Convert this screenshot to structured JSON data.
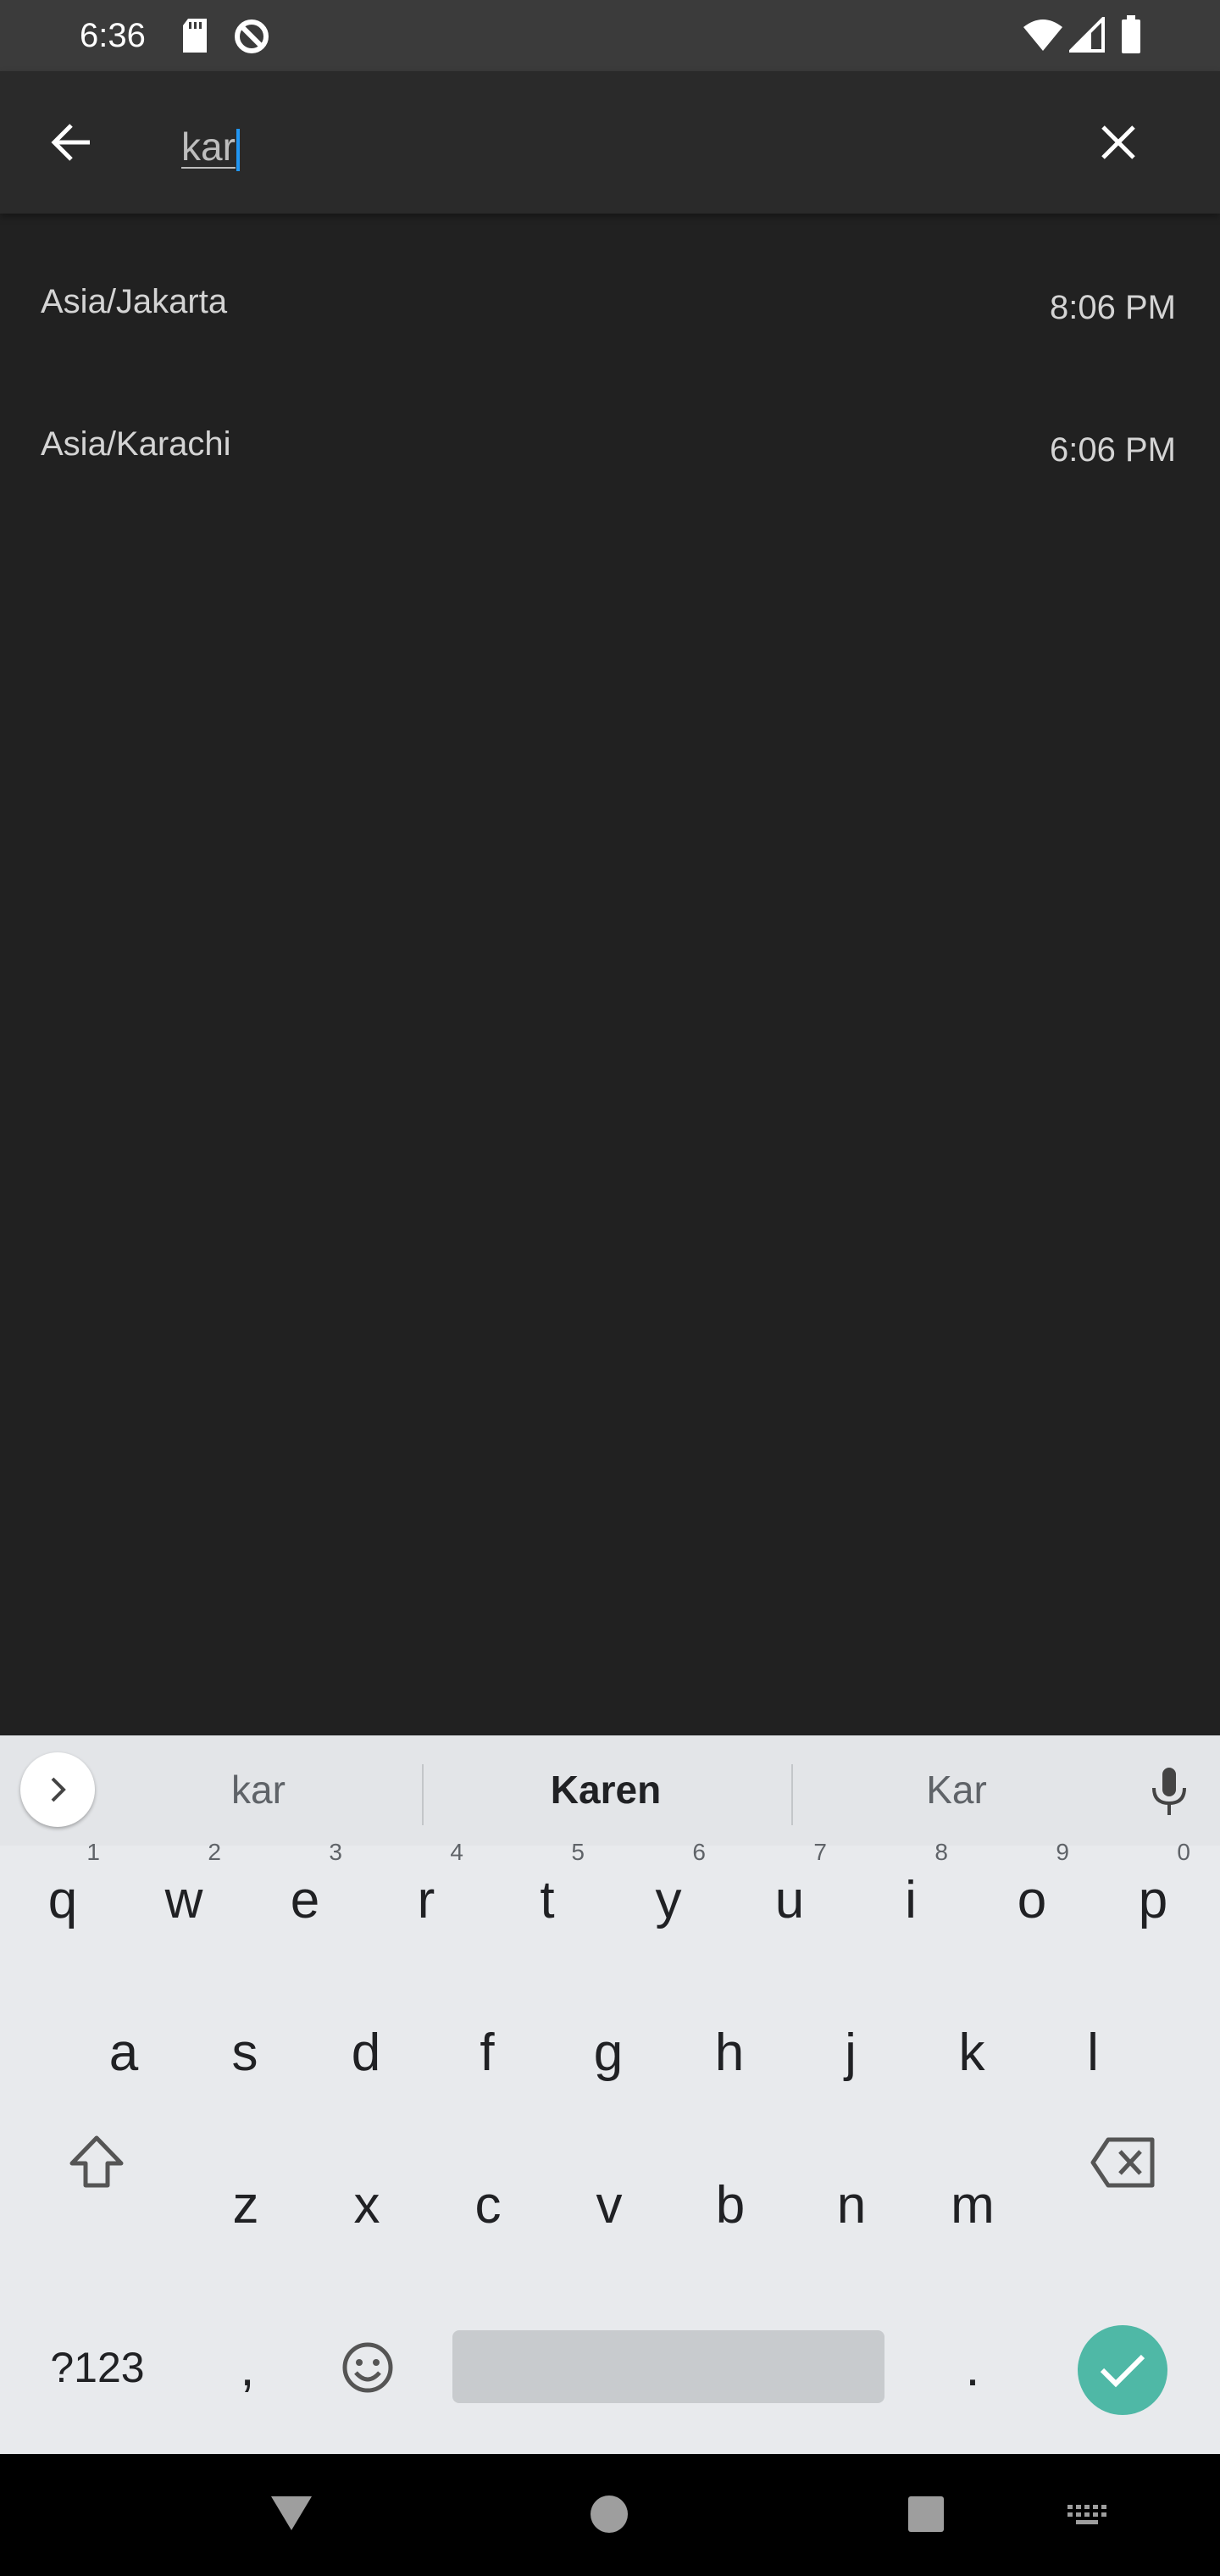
{
  "status_bar": {
    "time": "6:36",
    "icons": [
      "sd-card-icon",
      "do-not-disturb-icon",
      "wifi-icon",
      "signal-icon",
      "battery-icon"
    ]
  },
  "search_bar": {
    "query": "kar",
    "back_icon": "arrow-left-icon",
    "clear_icon": "close-icon"
  },
  "results": [
    {
      "zone": "Asia/Jakarta",
      "time": "8:06 PM"
    },
    {
      "zone": "Asia/Karachi",
      "time": "6:06 PM"
    }
  ],
  "keyboard": {
    "suggestions": [
      "kar",
      "Karen",
      "Kar"
    ],
    "rows": [
      [
        {
          "k": "q",
          "h": "1"
        },
        {
          "k": "w",
          "h": "2"
        },
        {
          "k": "e",
          "h": "3"
        },
        {
          "k": "r",
          "h": "4"
        },
        {
          "k": "t",
          "h": "5"
        },
        {
          "k": "y",
          "h": "6"
        },
        {
          "k": "u",
          "h": "7"
        },
        {
          "k": "i",
          "h": "8"
        },
        {
          "k": "o",
          "h": "9"
        },
        {
          "k": "p",
          "h": "0"
        }
      ],
      [
        {
          "k": "a"
        },
        {
          "k": "s"
        },
        {
          "k": "d"
        },
        {
          "k": "f"
        },
        {
          "k": "g"
        },
        {
          "k": "h"
        },
        {
          "k": "j"
        },
        {
          "k": "k"
        },
        {
          "k": "l"
        }
      ],
      [
        {
          "k": "z"
        },
        {
          "k": "x"
        },
        {
          "k": "c"
        },
        {
          "k": "v"
        },
        {
          "k": "b"
        },
        {
          "k": "n"
        },
        {
          "k": "m"
        }
      ]
    ],
    "symbols_label": "?123",
    "comma": ",",
    "period": ".",
    "accent_color": "#4fb8a6"
  },
  "nav_bar": {
    "icons": [
      "back-triangle-icon",
      "home-circle-icon",
      "recents-square-icon",
      "keyboard-switch-icon"
    ]
  }
}
